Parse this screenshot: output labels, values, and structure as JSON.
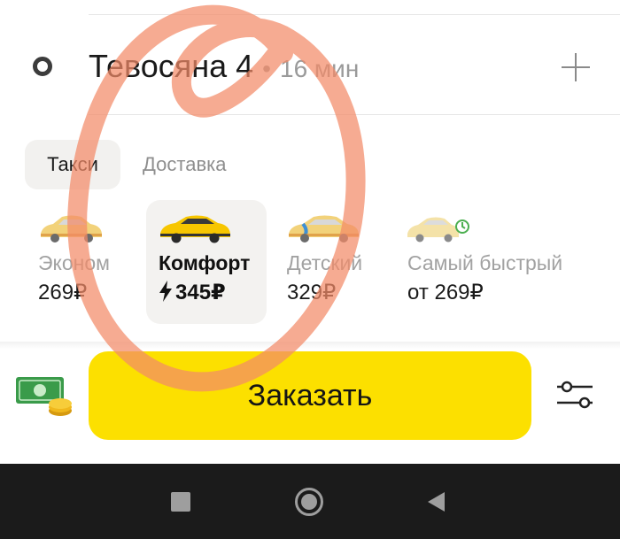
{
  "route": {
    "destination_label": "Тевосяна 4",
    "separator": "•",
    "eta": "16 мин"
  },
  "tabs": [
    {
      "label": "Такси",
      "active": true
    },
    {
      "label": "Доставка",
      "active": false
    }
  ],
  "tariffs": [
    {
      "name": "Эконом",
      "price": "269₽",
      "selected": false,
      "car_color": "#f2d27a"
    },
    {
      "name": "Комфорт",
      "price": "345₽",
      "selected": true,
      "surge_icon": "lightning-icon",
      "car_color": "#f7c600"
    },
    {
      "name": "Детский",
      "price": "329₽",
      "selected": false,
      "car_color": "#f2d27a"
    },
    {
      "name": "Самый быстрый",
      "price": "от 269₽",
      "selected": false,
      "car_color": "#f4e2a8"
    }
  ],
  "actions": {
    "order_label": "Заказать",
    "payment_icon": "cash-payment-icon",
    "settings_icon": "settings-sliders-icon"
  },
  "colors": {
    "accent": "#fce000",
    "annotation_scribble": "#f28a68"
  },
  "system_nav": {
    "recents_icon": "recents-square-icon",
    "home_icon": "home-circle-icon",
    "back_icon": "back-triangle-icon"
  }
}
